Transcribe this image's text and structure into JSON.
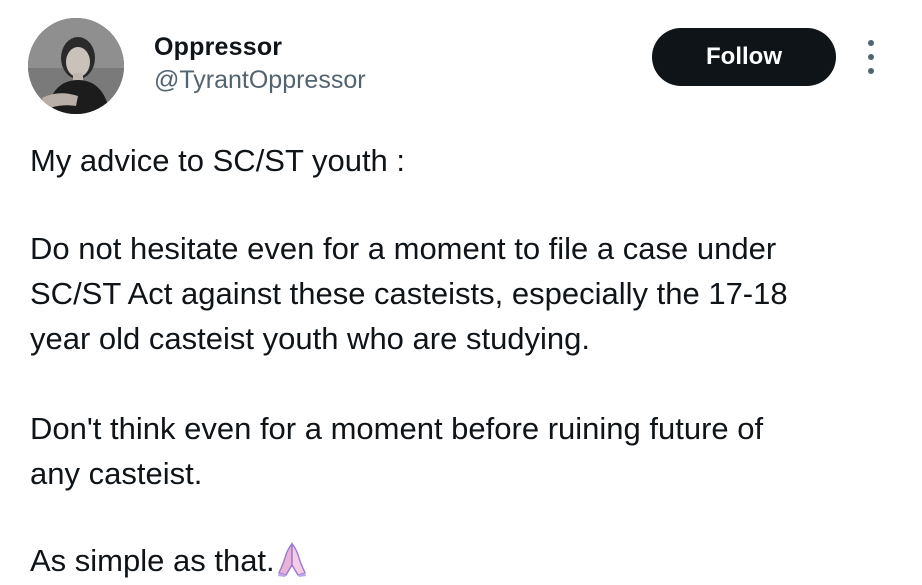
{
  "author": {
    "display_name": "Oppressor",
    "handle": "@TyrantOppressor",
    "avatar_icon": "profile-photo"
  },
  "actions": {
    "follow_label": "Follow",
    "more_icon": "more-options-icon"
  },
  "tweet": {
    "paragraphs": [
      "My advice to SC/ST youth :",
      "Do not hesitate even for a moment to file a case under\nSC/ST Act against these casteists, especially the 17-18\nyear old casteist youth who are studying.",
      "Don't think even for a moment before ruining future of\nany casteist.",
      "As simple as that."
    ],
    "trailing_emoji": "folded-hands-emoji"
  },
  "colors": {
    "text_primary": "#0f1419",
    "text_secondary": "#536471",
    "button_bg": "#0f1419",
    "button_text": "#ffffff"
  }
}
